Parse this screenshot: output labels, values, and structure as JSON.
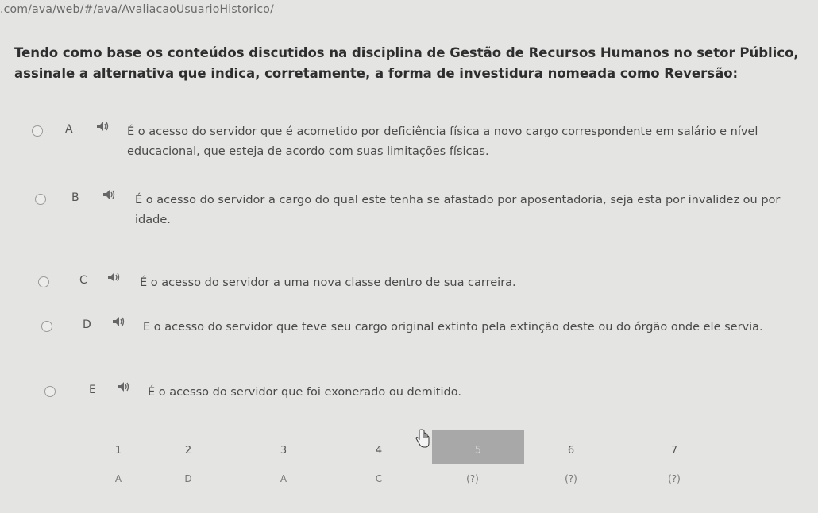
{
  "browser": {
    "url": ".com/ava/web/#/ava/AvaliacaoUsuarioHistorico/"
  },
  "question": {
    "text": "Tendo como base os conteúdos discutidos na disciplina de Gestão de Recursos Humanos no setor Público, assinale a alternativa que indica, corretamente, a forma de investidura nomeada como Reversão:"
  },
  "options": [
    {
      "letter": "A",
      "text": "É o acesso do servidor que é acometido por deficiência física a novo cargo correspondente em salário e nível educacional, que esteja de acordo com suas limitações físicas."
    },
    {
      "letter": "B",
      "text": "É o acesso do servidor a cargo do qual este tenha se afastado por aposentadoria, seja esta por invalidez ou por idade."
    },
    {
      "letter": "C",
      "text": "É o acesso do servidor a uma nova classe dentro de sua carreira."
    },
    {
      "letter": "D",
      "text": "E o acesso do servidor que teve seu cargo original extinto pela extinção deste ou do órgão onde ele servia."
    },
    {
      "letter": "E",
      "text": "É o acesso do servidor que foi exonerado ou demitido."
    }
  ],
  "navigation": [
    {
      "number": "1",
      "answer": "A"
    },
    {
      "number": "2",
      "answer": "D"
    },
    {
      "number": "3",
      "answer": "A"
    },
    {
      "number": "4",
      "answer": "C"
    },
    {
      "number": "5",
      "answer": "(?)",
      "active": true
    },
    {
      "number": "6",
      "answer": "(?)"
    },
    {
      "number": "7",
      "answer": "(?)"
    }
  ],
  "colors": {
    "background": "#e4e4e2",
    "active_nav": "#a8a8a8",
    "text": "#3a3a3a"
  },
  "icons": {
    "speaker": "speaker-icon",
    "radio": "radio-unchecked-icon",
    "cursor": "hand-pointer-icon"
  }
}
